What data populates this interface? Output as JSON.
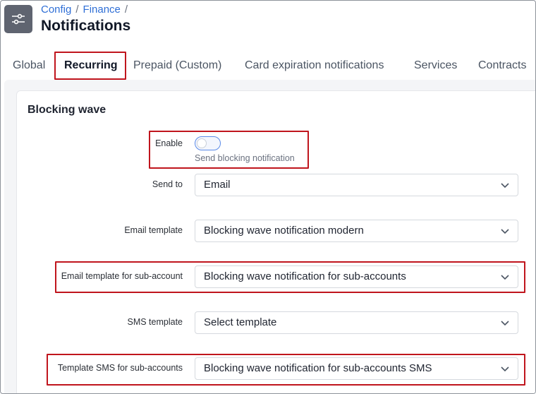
{
  "header": {
    "icon": "sliders-icon",
    "breadcrumb": [
      "Config",
      "Finance"
    ],
    "title": "Notifications"
  },
  "tabs": [
    {
      "label": "Global",
      "active": false
    },
    {
      "label": "Recurring",
      "active": true
    },
    {
      "label": "Prepaid (Custom)",
      "active": false
    },
    {
      "label": "Card expiration notifications",
      "active": false
    },
    {
      "label": "Services",
      "active": false
    },
    {
      "label": "Contracts",
      "active": false
    }
  ],
  "section": {
    "title": "Blocking wave",
    "enable": {
      "label": "Enable",
      "help": "Send blocking notification",
      "checked": false
    },
    "send_to": {
      "label": "Send to",
      "value": "Email"
    },
    "email_template": {
      "label": "Email template",
      "value": "Blocking wave notification modern"
    },
    "email_template_sub": {
      "label": "Email template for sub-account",
      "value": "Blocking wave notification for sub-accounts"
    },
    "sms_template": {
      "label": "SMS template",
      "value": "Select template"
    },
    "sms_template_sub": {
      "label": "Template SMS for sub-accounts",
      "value": "Blocking wave notification for sub-accounts SMS"
    }
  },
  "colors": {
    "accent": "#2f6fd6",
    "highlight": "#c0151d",
    "toggle_border": "#5b8be8"
  }
}
